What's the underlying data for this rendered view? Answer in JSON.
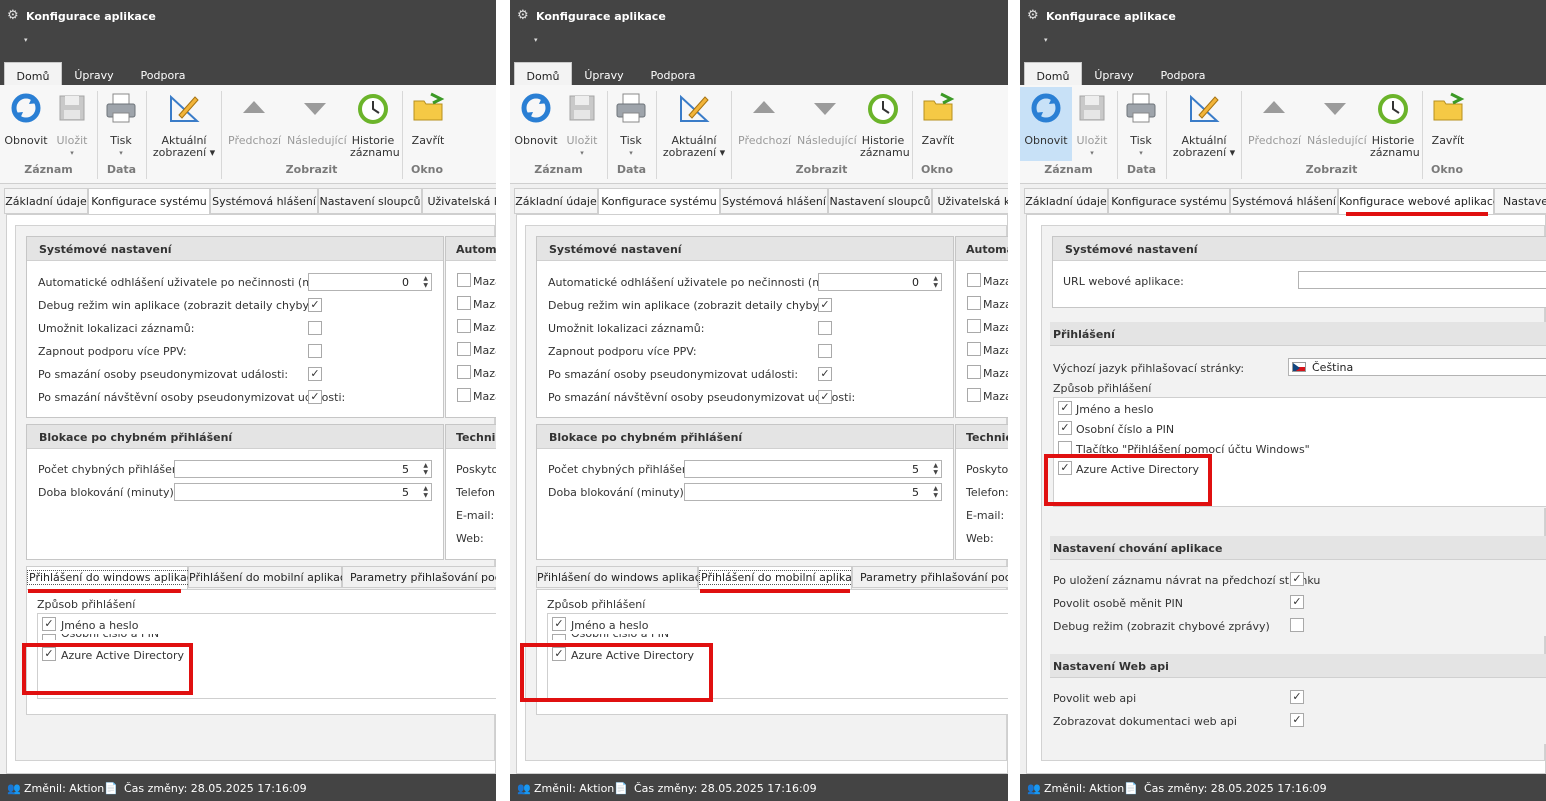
{
  "window": {
    "title": "Konfigurace aplikace",
    "qat_arrow": "▾"
  },
  "ribbon": {
    "tabs": [
      "Domů",
      "Úpravy",
      "Podpora"
    ],
    "buttons": {
      "refresh": "Obnovit",
      "save": "Uložit",
      "print": "Tisk",
      "current_view_1": "Aktuální",
      "current_view_2": "zobrazení ▾",
      "prev": "Předchozí",
      "next": "Následující",
      "history_1": "Historie",
      "history_2": "záznamu",
      "close": "Zavřít"
    },
    "groups": {
      "record": "Záznam",
      "data": "Data",
      "view": "Zobrazit",
      "window": "Okno"
    },
    "dropdown_mark": "▾"
  },
  "form_tabs": {
    "basic": "Základní údaje",
    "system_config": "Konfigurace systému",
    "system_messages": "Systémová hlášení",
    "column_settings": "Nastavení sloupců",
    "user_cut": "Uživatelská ko",
    "web_app_config": "Konfigurace webové aplikace",
    "settings_cut": "Nastaven"
  },
  "system_settings": {
    "header": "Systémové nastavení",
    "auto_logout_label": "Automatické odhlášení uživatele po nečinnosti (min):",
    "auto_logout_value": "0",
    "debug_label": "Debug režim win aplikace (zobrazit detaily chyby):",
    "localization_label": "Umožnit lokalizaci záznamů:",
    "ppv_label": "Zapnout podporu více PPV:",
    "pseudo_person_label": "Po smazání osoby pseudonymizovat události:",
    "pseudo_visitor_label": "Po smazání návštěvní osoby pseudonymizovat události:"
  },
  "auto_section": {
    "header": "Automa",
    "item": "Maza"
  },
  "block_section": {
    "header": "Blokace po chybném přihlášení",
    "attempts_label": "Počet chybných přihlášení:",
    "attempts_value": "5",
    "duration_label": "Doba blokování (minuty):",
    "duration_value": "5"
  },
  "tech_section": {
    "header": "Technic",
    "provider": "Poskytov",
    "phone": "Telefon:",
    "email": "E-mail:",
    "web": "Web:"
  },
  "login_tabs": {
    "windows": "Přihlášení do windows aplikace",
    "mobile": "Přihlášení do mobilní aplikace",
    "params": "Parametry přihlašování podle d",
    "params2": "Parametry přihlašování podle do"
  },
  "login_methods": {
    "label": "Způsob přihlášení",
    "name_password": "Jméno a heslo",
    "pin": "Osobní číslo a PIN",
    "azure": "Azure Active Directory",
    "windows_button": "Tlačítko \"Přihlášení pomocí účtu Windows\""
  },
  "web_config": {
    "system_header": "Systémové nastavení",
    "url_label": "URL webové aplikace:",
    "login_header": "Přihlášení",
    "default_lang_label": "Výchozí jazyk přihlašovací stránky:",
    "default_lang_value": "Čeština",
    "behavior_header": "Nastavení chování aplikace",
    "return_label": "Po uložení záznamu návrat na předchozí stránku",
    "allow_pin_label": "Povolit osobě měnit PIN",
    "debug_label": "Debug režim (zobrazit chybové zprávy)",
    "webapi_header": "Nastavení Web api",
    "allow_webapi_label": "Povolit web api",
    "show_docs_label": "Zobrazovat dokumentaci web api"
  },
  "status_bar": {
    "changed_by": "Změnil: Aktion",
    "changed_at": "Čas změny: 28.05.2025 17:16:09"
  },
  "colors": {
    "titlebar": "#444444",
    "highlight": "#e01010",
    "ribbon": "#f7f7f7",
    "selected_button": "#c8e1f7"
  },
  "check_mark": "✓",
  "spin_glyph": "▲▼"
}
